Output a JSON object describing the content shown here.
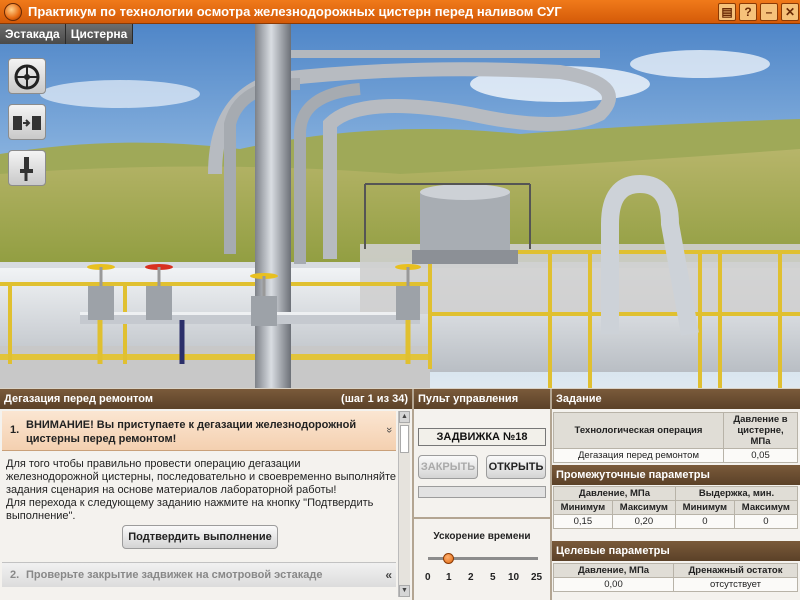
{
  "window": {
    "title": "Практикум по технологии осмотра железнодорожных цистерн перед наливом СУГ",
    "controls": [
      "▤",
      "?",
      "–",
      "✕"
    ]
  },
  "tabs": [
    {
      "label": "Эстакада"
    },
    {
      "label": "Цистерна"
    }
  ],
  "tools": [
    {
      "icon": "valve-wheel-icon"
    },
    {
      "icon": "coupling-icon"
    },
    {
      "icon": "wrench-icon"
    }
  ],
  "scenario": {
    "title": "Дегазация перед ремонтом",
    "step_counter": "(шаг 1 из 34)",
    "active_step": {
      "number": "1.",
      "title": "ВНИМАНИЕ! Вы приступаете к дегазации железнодорожной цистерны перед ремонтом!",
      "chevron": "»",
      "description": "Для того чтобы правильно провести операцию дегазации железнодорожной цистерны, последовательно и своевременно выполняйте задания сценария на основе материалов лабораторной работы!\nДля перехода к следующему заданию нажмите на кнопку \"Подтвердить выполнение\".",
      "confirm_button": "Подтвердить выполнение"
    },
    "next_step": {
      "number": "2.",
      "title": "Проверьте закрытие задвижек на смотровой эстакаде",
      "chevron": "«"
    }
  },
  "control_panel": {
    "title": "Пульт управления",
    "valve_display": "ЗАДВИЖКА №18",
    "close_button": "ЗАКРЫТЬ",
    "open_button": "ОТКРЫТЬ",
    "progress": 0,
    "speed_label": "Ускорение времени",
    "speed_ticks": [
      "0",
      "1",
      "2",
      "5",
      "10",
      "25"
    ],
    "speed_value": "1"
  },
  "task": {
    "title": "Задание",
    "headers": [
      "Технологическая операция",
      "Давление в цистерне, МПа"
    ],
    "row": [
      "Дегазация перед ремонтом",
      "0,05"
    ]
  },
  "intermediate": {
    "title": "Промежуточные параметры",
    "group_headers": [
      "Давление, МПа",
      "Выдержка, мин."
    ],
    "sub_headers": [
      "Минимум",
      "Максимум",
      "Минимум",
      "Максимум"
    ],
    "row": [
      "0,15",
      "0,20",
      "0",
      "0"
    ]
  },
  "target": {
    "title": "Целевые параметры",
    "headers": [
      "Давление, МПа",
      "Дренажный остаток"
    ],
    "row": [
      "0,00",
      "отсутствует"
    ]
  },
  "valves": {
    "colors": {
      "yellow": "#e8c020",
      "red": "#d83020"
    }
  }
}
